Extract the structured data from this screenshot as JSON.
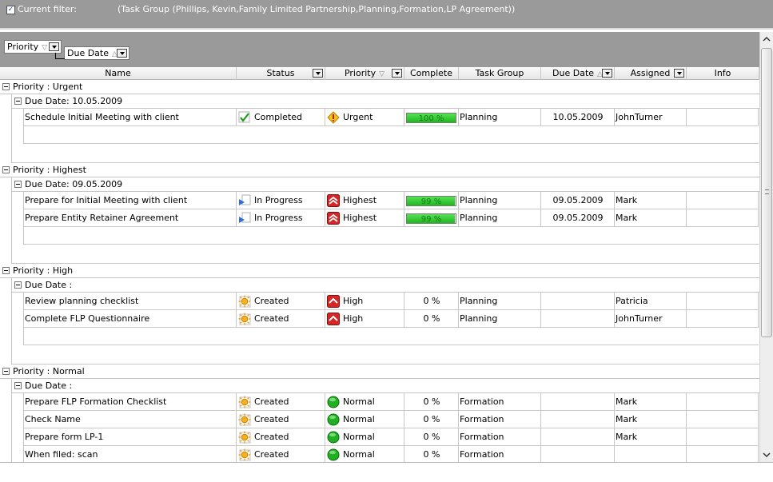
{
  "filter": {
    "checked": true,
    "label": "Current filter:",
    "value": "(Task Group  (Phillips, Kevin,Family Limited Partnership,Planning,Formation,LP Agreement))"
  },
  "group_by": {
    "chips": [
      {
        "label": "Priority",
        "sort": "▽"
      },
      {
        "label": "Due Date",
        "sort": "△"
      }
    ]
  },
  "columns": [
    {
      "label": "Name"
    },
    {
      "label": "Status"
    },
    {
      "label": "Priority",
      "sort": "▽"
    },
    {
      "label": "Complete"
    },
    {
      "label": "Task Group"
    },
    {
      "label": "Due Date",
      "sort": "△"
    },
    {
      "label": "Assigned"
    },
    {
      "label": "Info"
    }
  ],
  "groups": [
    {
      "label": "Priority : Urgent",
      "subgroups": [
        {
          "label": "Due Date: 10.05.2009",
          "rows": [
            {
              "name": "Schedule Initial Meeting with client",
              "status": "Completed",
              "status_icon": "check-icon",
              "priority": "Urgent",
              "priority_icon": "warning-icon",
              "complete_text": "100 %",
              "complete": 100,
              "task_group": "Planning",
              "due_date": "10.05.2009",
              "assigned": "JohnTurner",
              "info": ""
            }
          ]
        }
      ]
    },
    {
      "label": "Priority : Highest",
      "subgroups": [
        {
          "label": "Due Date: 09.05.2009",
          "rows": [
            {
              "name": "Prepare for Initial Meeting with client",
              "status": "In Progress",
              "status_icon": "progress-flag-icon",
              "priority": "Highest",
              "priority_icon": "double-up-arrow-icon",
              "complete_text": "99 %",
              "complete": 99,
              "task_group": "Planning",
              "due_date": "09.05.2009",
              "assigned": "Mark",
              "info": ""
            },
            {
              "name": "Prepare Entity Retainer Agreement",
              "status": "In Progress",
              "status_icon": "progress-flag-icon",
              "priority": "Highest",
              "priority_icon": "double-up-arrow-icon",
              "complete_text": "99 %",
              "complete": 99,
              "task_group": "Planning",
              "due_date": "09.05.2009",
              "assigned": "Mark",
              "info": ""
            }
          ]
        }
      ]
    },
    {
      "label": "Priority : High",
      "subgroups": [
        {
          "label": "Due Date :",
          "rows": [
            {
              "name": "Review planning checklist",
              "status": "Created",
              "status_icon": "sun-icon",
              "priority": "High",
              "priority_icon": "up-arrow-icon",
              "complete_text": "0 %",
              "complete": 0,
              "task_group": "Planning",
              "due_date": "",
              "assigned": "Patricia",
              "info": ""
            },
            {
              "name": "Complete FLP Questionnaire",
              "status": "Created",
              "status_icon": "sun-icon",
              "priority": "High",
              "priority_icon": "up-arrow-icon",
              "complete_text": "0 %",
              "complete": 0,
              "task_group": "Planning",
              "due_date": "",
              "assigned": "JohnTurner",
              "info": ""
            }
          ]
        }
      ]
    },
    {
      "label": "Priority : Normal",
      "subgroups": [
        {
          "label": "Due Date :",
          "rows": [
            {
              "name": "Prepare FLP Formation Checklist",
              "status": "Created",
              "status_icon": "sun-icon",
              "priority": "Normal",
              "priority_icon": "green-circle-icon",
              "complete_text": "0 %",
              "complete": 0,
              "task_group": "Formation",
              "due_date": "",
              "assigned": "Mark",
              "info": ""
            },
            {
              "name": "Check Name",
              "status": "Created",
              "status_icon": "sun-icon",
              "priority": "Normal",
              "priority_icon": "green-circle-icon",
              "complete_text": "0 %",
              "complete": 0,
              "task_group": "Formation",
              "due_date": "",
              "assigned": "Mark",
              "info": ""
            },
            {
              "name": "Prepare form LP-1",
              "status": "Created",
              "status_icon": "sun-icon",
              "priority": "Normal",
              "priority_icon": "green-circle-icon",
              "complete_text": "0 %",
              "complete": 0,
              "task_group": "Formation",
              "due_date": "",
              "assigned": "Mark",
              "info": ""
            },
            {
              "name": "When filed:  scan",
              "status": "Created",
              "status_icon": "sun-icon",
              "priority": "Normal",
              "priority_icon": "green-circle-icon",
              "complete_text": "0 %",
              "complete": 0,
              "task_group": "Formation",
              "due_date": "",
              "assigned": "",
              "info": ""
            }
          ]
        }
      ]
    }
  ]
}
